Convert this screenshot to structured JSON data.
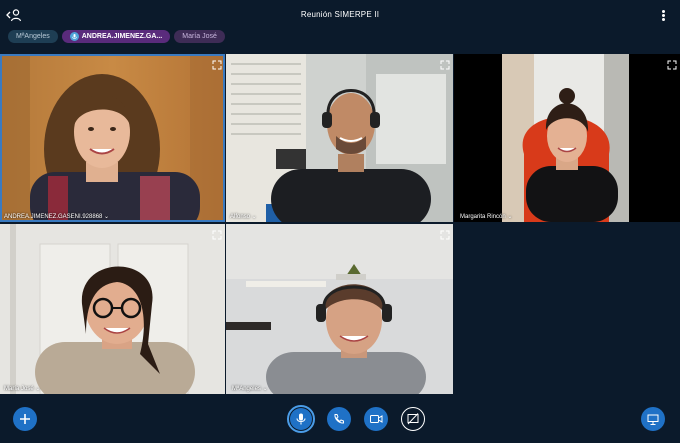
{
  "header": {
    "title": "Reunión SIMERPE II"
  },
  "talkers": [
    {
      "label": "MªAngeles"
    },
    {
      "label": "ANDREA.JIMENEZ.GA..."
    },
    {
      "label": "María José"
    }
  ],
  "tiles": [
    {
      "name": "ANDREA.JIMENEZ.GASENI.928868"
    },
    {
      "name": "Alfonso"
    },
    {
      "name": "Margarita Rincón"
    },
    {
      "name": "María José"
    },
    {
      "name": "MªAngeles"
    }
  ],
  "icons": {
    "users": "users-icon",
    "menu": "more-vertical-icon",
    "fullscreen": "fullscreen-icon",
    "add": "plus-icon",
    "mic": "microphone-icon",
    "phone": "phone-icon",
    "camera": "video-camera-icon",
    "screenshare": "screen-share-off-icon",
    "presentation": "presentation-icon"
  },
  "colors": {
    "background": "#0b1a2b",
    "active_border": "#3a7ac0",
    "button_blue": "#1f71c6",
    "chip_talking": "#5a2b7c"
  }
}
